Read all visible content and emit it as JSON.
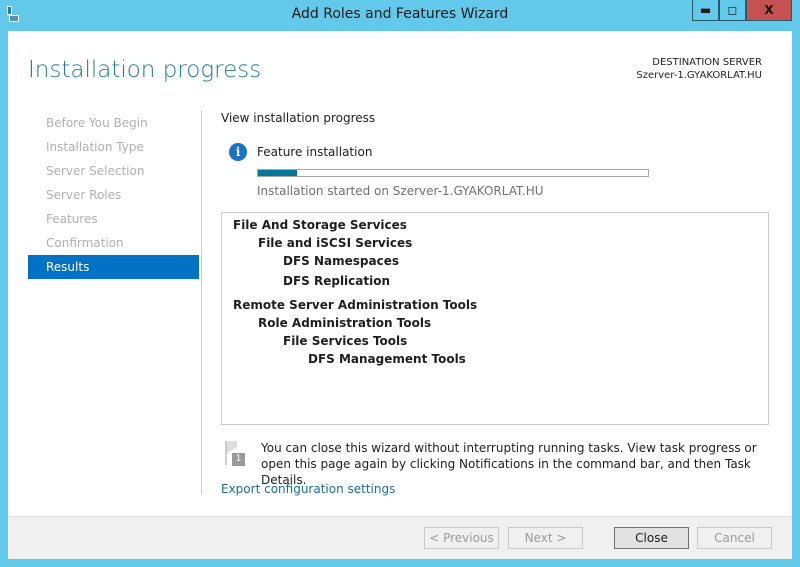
{
  "window": {
    "title": "Add Roles and Features Wizard",
    "minimize": "▬",
    "maximize": "◻",
    "close": "X"
  },
  "header": {
    "title": "Installation progress",
    "destination_label": "DESTINATION SERVER",
    "destination_server": "Szerver-1.GYAKORLAT.HU"
  },
  "sidebar": {
    "items": [
      {
        "label": "Before You Begin"
      },
      {
        "label": "Installation Type"
      },
      {
        "label": "Server Selection"
      },
      {
        "label": "Server Roles"
      },
      {
        "label": "Features"
      },
      {
        "label": "Confirmation"
      },
      {
        "label": "Results",
        "active": true
      }
    ]
  },
  "main": {
    "heading": "View installation progress",
    "status_title": "Feature installation",
    "progress_percent": 10,
    "progress_color": "#00789a",
    "status_text": "Installation started on Szerver-1.GYAKORLAT.HU",
    "tree": [
      {
        "label": "File And Storage Services",
        "level": 0
      },
      {
        "label": "File and iSCSI Services",
        "level": 1
      },
      {
        "label": "DFS Namespaces",
        "level": 2
      },
      {
        "label": "DFS Replication",
        "level": 2
      },
      {
        "label": "Remote Server Administration Tools",
        "level": 0
      },
      {
        "label": "Role Administration Tools",
        "level": 1
      },
      {
        "label": "File Services Tools",
        "level": 2
      },
      {
        "label": "DFS Management Tools",
        "level": 3
      }
    ],
    "note": "You can close this wizard without interrupting running tasks. View task progress or open this page again by clicking Notifications in the command bar, and then Task Details.",
    "notification_badge": "1",
    "export_link": "Export configuration settings"
  },
  "footer": {
    "previous": "< Previous",
    "next": "Next >",
    "close": "Close",
    "cancel": "Cancel"
  },
  "colors": {
    "titlebar": "#63c9ea",
    "accent": "#0072c6",
    "close_button": "#c75050"
  }
}
